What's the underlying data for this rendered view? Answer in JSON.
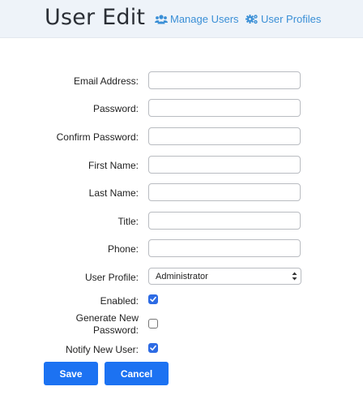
{
  "header": {
    "title": "User Edit",
    "nav": {
      "manage_users": "Manage Users",
      "user_profiles": "User Profiles"
    }
  },
  "form": {
    "email": {
      "label": "Email Address:",
      "value": ""
    },
    "password": {
      "label": "Password:",
      "value": ""
    },
    "confirm_password": {
      "label": "Confirm Password:",
      "value": ""
    },
    "first_name": {
      "label": "First Name:",
      "value": ""
    },
    "last_name": {
      "label": "Last Name:",
      "value": ""
    },
    "title": {
      "label": "Title:",
      "value": ""
    },
    "phone": {
      "label": "Phone:",
      "value": ""
    },
    "user_profile": {
      "label": "User Profile:",
      "value": "Administrator"
    },
    "enabled": {
      "label": "Enabled:",
      "checked": true
    },
    "generate_password": {
      "label_line1": "Generate New",
      "label_line2": "Password:",
      "checked": false
    },
    "notify_user": {
      "label": "Notify New User:",
      "checked": true
    }
  },
  "buttons": {
    "save": "Save",
    "cancel": "Cancel"
  },
  "colors": {
    "accent": "#1c72f2",
    "link": "#3a8fd6",
    "header_bg": "#eef3f9",
    "checkbox_checked": "#2d6be4"
  },
  "icons": {
    "manage_users": "users-icon",
    "user_profiles": "gears-icon"
  }
}
